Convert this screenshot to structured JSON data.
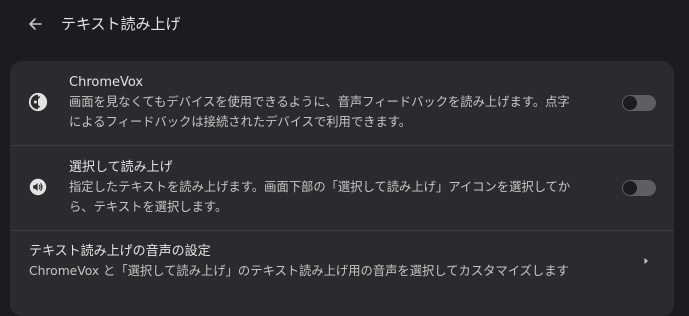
{
  "header": {
    "back_icon": "arrow-back-icon",
    "title": "テキスト読み上げ"
  },
  "settings": {
    "chromevox": {
      "icon": "chromevox-icon",
      "title": "ChromeVox",
      "description_line1": "画面を見なくてもデバイスを使用できるように、音声フィードバックを読み上げます。点字",
      "description_line2": "によるフィードバックは接続されたデバイスで利用できます。",
      "enabled": false
    },
    "select_to_speak": {
      "icon": "select-to-speak-icon",
      "title": "選択して読み上げ",
      "description_line1": "指定したテキストを読み上げます。画面下部の「選択して読み上げ」アイコンを選択してか",
      "description_line2": "ら、テキストを選択します。",
      "enabled": false
    },
    "tts_voice": {
      "title": "テキスト読み上げの音声の設定",
      "description": "ChromeVox と「選択して読み上げ」のテキスト読み上げ用の音声を選択してカスタマイズします",
      "chevron_icon": "chevron-right-icon"
    }
  },
  "colors": {
    "background": "#1b1c1f",
    "card": "#2a2b2e",
    "divider": "#3c3d40",
    "text_primary": "#e3e3e3",
    "text_secondary": "#c4c7c5",
    "toggle_off_track": "#5e5f62"
  }
}
